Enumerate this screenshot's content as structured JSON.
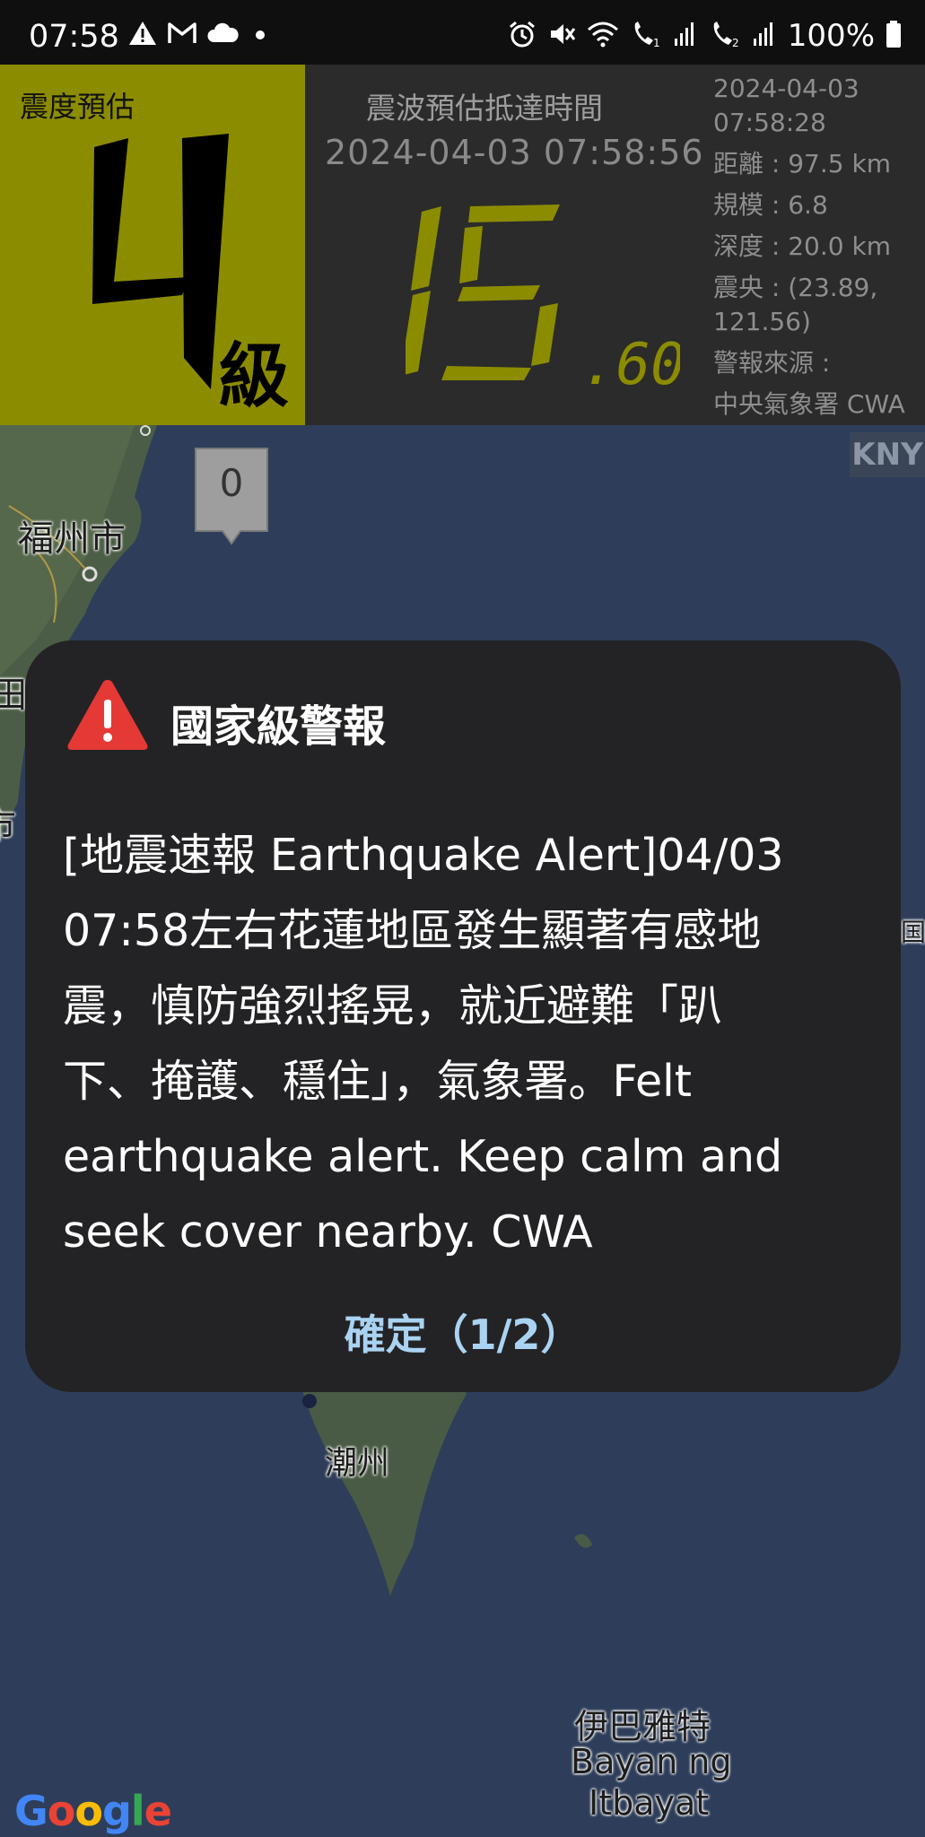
{
  "status_bar": {
    "time": "07:58",
    "battery_text": "100%",
    "left_icons": [
      "warning-icon",
      "gmail-icon",
      "cloud-icon",
      "dot-icon"
    ],
    "right_icons": [
      "alarm-icon",
      "mute-icon",
      "wifi-icon",
      "wifi-call-1-icon",
      "signal-1-icon",
      "wifi-call-2-icon",
      "signal-2-icon",
      "battery-icon"
    ]
  },
  "header": {
    "intensity_label": "震度預估",
    "intensity_value": "4",
    "intensity_unit": "級",
    "arrival_title": "震波預估抵達時間",
    "arrival_time": "2024-04-03 07:58:56",
    "countdown_seconds": "15",
    "countdown_decimal": ".60",
    "info": {
      "date": "2024-04-03",
      "time": "07:58:28",
      "distance": "距離 : 97.5 km",
      "magnitude": "規模 : 6.8",
      "depth": "深度 : 20.0 km",
      "epicenter_1": "震央 : (23.89,",
      "epicenter_2": "121.56)",
      "source_label": "警報來源 :",
      "source_value": "中央氣象署 CWA"
    },
    "colors": {
      "intensity_bg": "#8c8c00",
      "countdown": "#8c8c00"
    }
  },
  "map": {
    "kny": "KNY",
    "marker_value": "0",
    "labels": {
      "fuzhou": "福州市",
      "chaozhou": "潮州",
      "ivatan": "伊巴雅特",
      "bayan": "Bayan ng",
      "itbayat": "Itbayat"
    },
    "partial_labels": {
      "left_1": "田",
      "left_2": "市",
      "right_1": "国"
    },
    "google": [
      "G",
      "o",
      "o",
      "g",
      "l",
      "e"
    ]
  },
  "dialog": {
    "title": "國家級警報",
    "body": "[地震速報 Earthquake Alert]04/03\n07:58左右花蓮地區發生顯著有感地\n震，慎防強烈搖晃，就近避難「趴\n下、掩護、穩住」，氣象署。Felt\nearthquake alert. Keep calm and\nseek cover nearby. CWA",
    "button": "確定（1/2）",
    "icon": "warning-triangle-icon",
    "colors": {
      "bg": "#232325",
      "button": "#aad3f2",
      "icon": "#e53935"
    }
  }
}
